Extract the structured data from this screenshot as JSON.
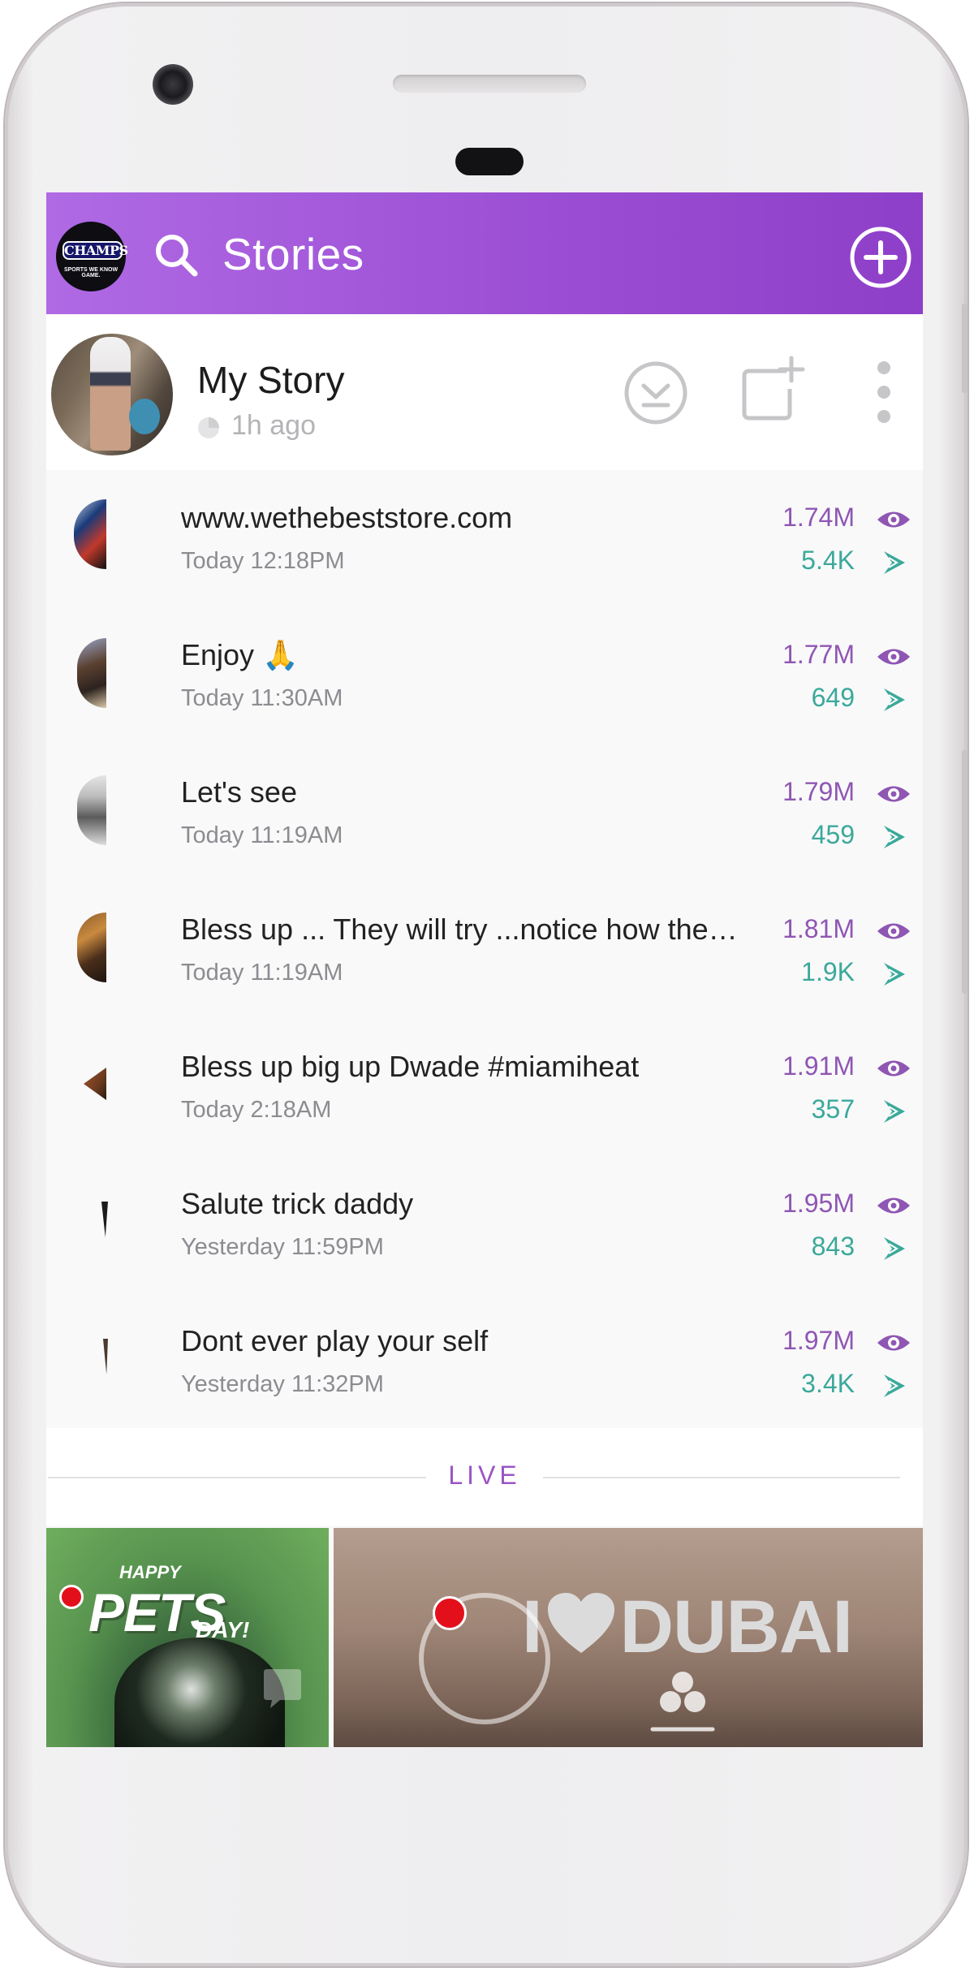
{
  "header": {
    "logo_name": "CHAMPS",
    "logo_sub": "SPORTS WE KNOW GAME.",
    "title": "Stories",
    "color_start": "#b06ae4",
    "color_end": "#8e3fc9"
  },
  "my_story": {
    "name": "My Story",
    "time": "1h ago"
  },
  "snaps": [
    {
      "title": "www.wethebeststore.com",
      "time": "Today 12:18PM",
      "views": "1.74M",
      "screenshots": "5.4K"
    },
    {
      "title": "Enjoy 🙏",
      "time": "Today 11:30AM",
      "views": "1.77M",
      "screenshots": "649"
    },
    {
      "title": "Let's see",
      "time": "Today 11:19AM",
      "views": "1.79M",
      "screenshots": "459"
    },
    {
      "title": "Bless up ... They will try ...notice how they still trying",
      "time": "Today 11:19AM",
      "views": "1.81M",
      "screenshots": "1.9K"
    },
    {
      "title": "Bless up big up Dwade #miamiheat",
      "time": "Today 2:18AM",
      "views": "1.91M",
      "screenshots": "357"
    },
    {
      "title": "Salute trick daddy",
      "time": "Yesterday 11:59PM",
      "views": "1.95M",
      "screenshots": "843"
    },
    {
      "title": "Dont ever play your self",
      "time": "Yesterday 11:32PM",
      "views": "1.97M",
      "screenshots": "3.4K"
    }
  ],
  "live": {
    "label": "LIVE",
    "tiles": [
      {
        "happy": "HAPPY",
        "title": "PETS",
        "day": "DAY!"
      },
      {
        "title": "DUBAI"
      }
    ]
  },
  "colors": {
    "views": "#8f56b3",
    "screenshots": "#3ba99a",
    "live_label": "#9a56c6",
    "recording": "#e3101b"
  }
}
